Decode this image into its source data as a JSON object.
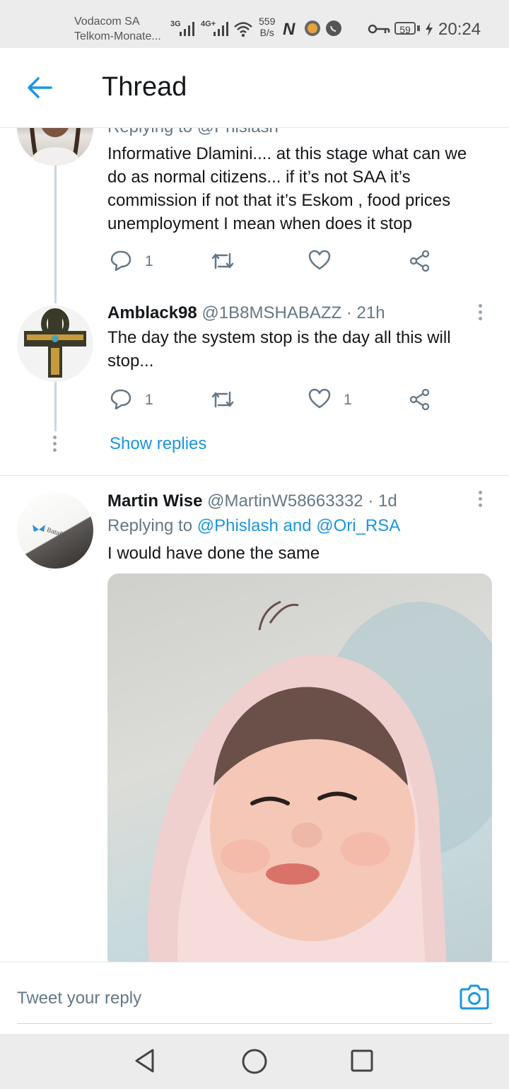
{
  "status_bar": {
    "carrier_1": "Vodacom SA",
    "carrier_2": "Telkom-Monate...",
    "net_1": "3G",
    "net_2": "4G+",
    "speed_value": "559",
    "speed_unit": "B/s",
    "battery": "59",
    "time": "20:24"
  },
  "header": {
    "title": "Thread"
  },
  "tweets": [
    {
      "reply_partial": "Replying to @Phislash",
      "text": "Informative Dlamini.... at this stage what can we do as normal citizens... if it’s not SAA it’s commission if not that it’s Eskom , food prices unemployment I mean when does it stop",
      "reply_count": "1",
      "retweet_count": "",
      "like_count": ""
    },
    {
      "name": "Amblack98",
      "handle": "@1B8MSHABAZZ",
      "time": "· 21h",
      "text": "The day the system stop is the day all this will stop...",
      "reply_count": "1",
      "retweet_count": "",
      "like_count": "1"
    },
    {
      "name": "Martin Wise",
      "handle": "@MartinW58663332",
      "time": "· 1d",
      "replying_prefix": "Replying to",
      "replying_user_1": "@Phislash",
      "replying_and": "and",
      "replying_user_2": "@Ori_RSA",
      "text": "I would have done the same",
      "avatar_caption": "Batafly"
    }
  ],
  "show_replies": "Show replies",
  "reply_bar": {
    "placeholder": "Tweet your reply"
  },
  "colors": {
    "accent": "#1b95e0",
    "text": "#14171a",
    "muted": "#657786",
    "divider": "#e1e8ed"
  },
  "icons": [
    "back-arrow-icon",
    "reply-icon",
    "retweet-icon",
    "like-icon",
    "share-icon",
    "more-icon",
    "camera-icon",
    "nav-back-icon",
    "nav-home-icon",
    "nav-recents-icon"
  ]
}
